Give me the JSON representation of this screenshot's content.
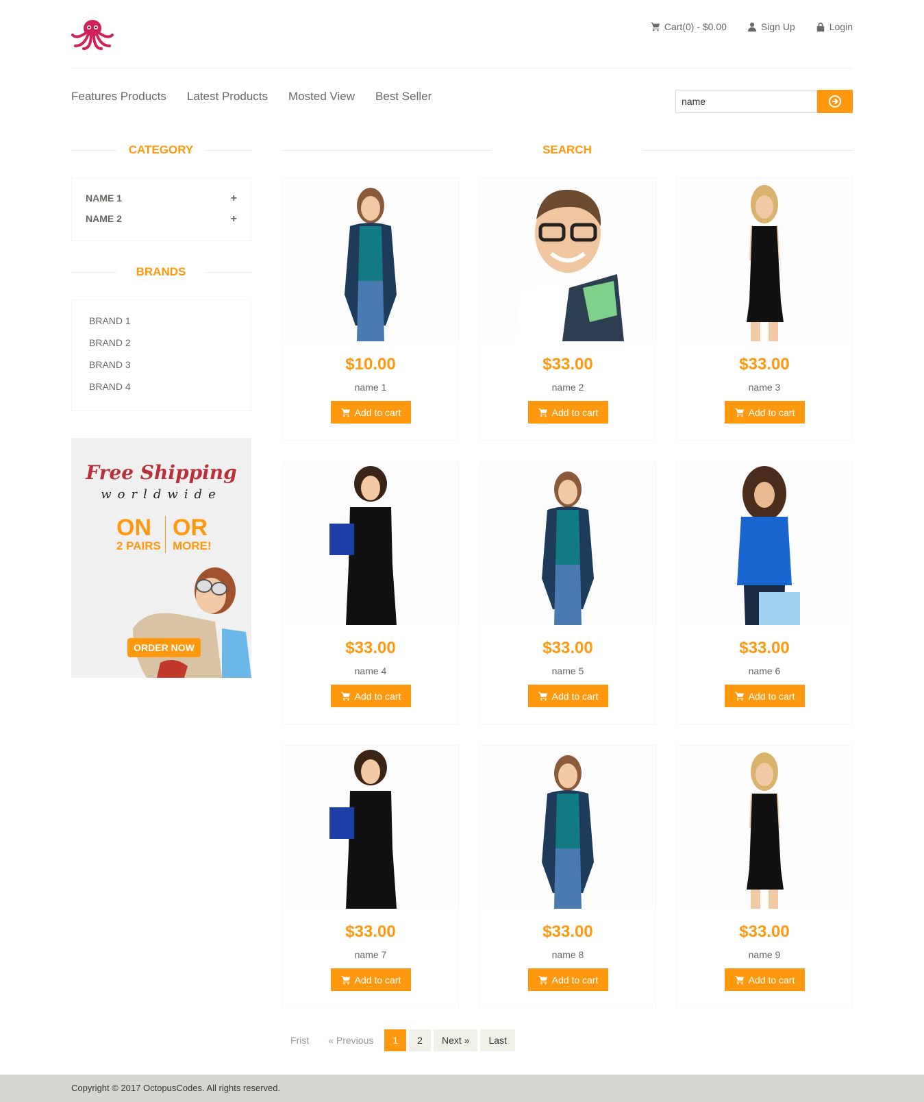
{
  "header": {
    "cart_label": "Cart(0) - $0.00",
    "signup_label": "Sign Up",
    "login_label": "Login"
  },
  "menu": [
    "Features Products",
    "Latest Products",
    "Mosted View",
    "Best Seller"
  ],
  "search": {
    "value": "name"
  },
  "sidebar": {
    "category_title": "CATEGORY",
    "categories": [
      "NAME 1",
      "NAME 2"
    ],
    "brands_title": "BRANDS",
    "brands": [
      "BRAND 1",
      "BRAND 2",
      "BRAND 3",
      "BRAND 4"
    ]
  },
  "banner": {
    "line1": "Free Shipping",
    "line2": "worldwide",
    "on": "ON",
    "pairs": "2 PAIRS",
    "or": "OR",
    "more": "MORE!",
    "cta": "ORDER NOW"
  },
  "main": {
    "title": "SEARCH",
    "add_label": "Add to cart",
    "products": [
      {
        "price": "$10.00",
        "name": "name 1",
        "figure": "woman-cardigan"
      },
      {
        "price": "$33.00",
        "name": "name 2",
        "figure": "man-glasses"
      },
      {
        "price": "$33.00",
        "name": "name 3",
        "figure": "woman-black-dress"
      },
      {
        "price": "$33.00",
        "name": "name 4",
        "figure": "woman-bag"
      },
      {
        "price": "$33.00",
        "name": "name 5",
        "figure": "woman-cardigan"
      },
      {
        "price": "$33.00",
        "name": "name 6",
        "figure": "woman-blue-top"
      },
      {
        "price": "$33.00",
        "name": "name 7",
        "figure": "woman-bag"
      },
      {
        "price": "$33.00",
        "name": "name 8",
        "figure": "woman-cardigan"
      },
      {
        "price": "$33.00",
        "name": "name 9",
        "figure": "woman-black-dress"
      }
    ]
  },
  "pagination": {
    "first": "Frist",
    "previous": "« Previous",
    "pages": [
      "1",
      "2"
    ],
    "current": "1",
    "next": "Next »",
    "last": "Last"
  },
  "footer": {
    "copyright": "Copyright © 2017 OctopusCodes. All rights reserved."
  },
  "colors": {
    "accent": "#fe980f",
    "footer_bg": "#d6d6d0",
    "logo": "#d1205a"
  }
}
